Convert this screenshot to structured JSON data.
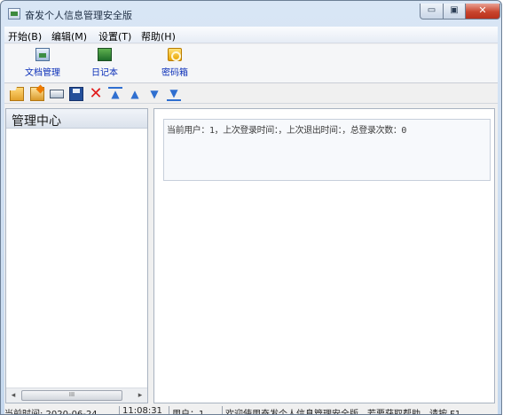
{
  "window": {
    "title": "奋发个人信息管理安全版",
    "minimize_glyph": "▭",
    "maximize_glyph": "▣",
    "close_glyph": "✕"
  },
  "menu": [
    "开始(B)",
    "编辑(M)",
    "设置(T)",
    "帮助(H)"
  ],
  "big_toolbar": [
    {
      "label": "文档管理",
      "icon": "document-manager-icon"
    },
    {
      "label": "日记本",
      "icon": "diary-icon"
    },
    {
      "label": "密码箱",
      "icon": "password-box-icon"
    }
  ],
  "small_toolbar": [
    {
      "icon": "open-folder-icon"
    },
    {
      "icon": "close-folder-icon"
    },
    {
      "icon": "properties-icon"
    },
    {
      "icon": "save-icon"
    },
    {
      "icon": "delete-icon",
      "glyph": "✕"
    },
    {
      "icon": "move-top-icon",
      "glyph": "▲"
    },
    {
      "icon": "move-up-icon",
      "glyph": "▲"
    },
    {
      "icon": "move-down-icon",
      "glyph": "▼"
    },
    {
      "icon": "move-bottom-icon",
      "glyph": "▼"
    }
  ],
  "tree": {
    "header": "管理中心",
    "scroll_left": "◂",
    "scroll_right": "▸",
    "scroll_grip": "III"
  },
  "content": {
    "info": "当前用户：1，上次登录时间：，上次退出时间：，总登录次数：0"
  },
  "status": {
    "date": "当前时间: 2020-06-24",
    "time": "11:08:31",
    "user": "用户：1",
    "message": "欢迎使用奋发个人信息管理安全版，若要获取帮助，请按 F1"
  },
  "colors": {
    "toolbar_label": "#0b2fb8",
    "close_button": "#c9452e",
    "delete_icon": "#e11b1b",
    "arrow_icon": "#2f6fd0"
  }
}
